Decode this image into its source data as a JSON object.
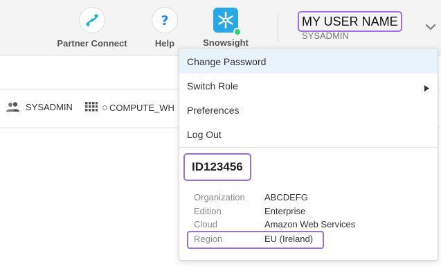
{
  "topbar": {
    "partner_connect_label": "Partner Connect",
    "help_label": "Help",
    "snowsight_label": "Snowsight",
    "user_name": "MY USER NAME",
    "user_role": "SYSADMIN"
  },
  "context": {
    "role": "SYSADMIN",
    "warehouse": "COMPUTE_WH"
  },
  "menu": {
    "items": [
      {
        "label": "Change Password"
      },
      {
        "label": "Switch Role"
      },
      {
        "label": "Preferences"
      },
      {
        "label": "Log Out"
      }
    ],
    "account_id": "ID123456",
    "details": [
      {
        "label": "Organization",
        "value": "ABCDEFG"
      },
      {
        "label": "Edition",
        "value": "Enterprise"
      },
      {
        "label": "Cloud",
        "value": "Amazon Web Services"
      },
      {
        "label": "Region",
        "value": "EU (Ireland)"
      }
    ]
  },
  "colors": {
    "highlight_border": "#9b6ee6",
    "snowsight_brand": "#29a8e8",
    "status_green": "#34d17a",
    "menu_hover": "#e9f3fb"
  },
  "icons": [
    "partner-connect-icon",
    "help-icon",
    "snowsight-icon",
    "chevron-down-icon",
    "role-users-icon",
    "warehouse-grid-icon",
    "submenu-arrow-icon"
  ]
}
